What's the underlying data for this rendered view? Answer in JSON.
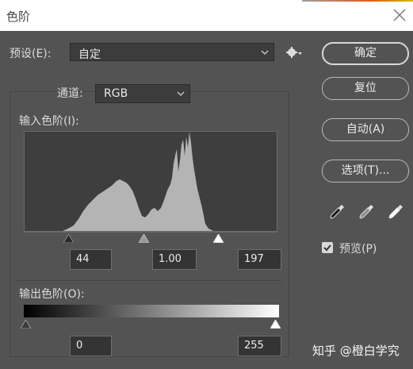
{
  "window": {
    "title": "色阶"
  },
  "preset": {
    "label": "预设(E):",
    "value": "自定"
  },
  "channel": {
    "label": "通道:",
    "value": "RGB"
  },
  "input_levels": {
    "label": "输入色阶(I):",
    "black": "44",
    "gamma": "1.00",
    "white": "197"
  },
  "output_levels": {
    "label": "输出色阶(O):",
    "black": "0",
    "white": "255"
  },
  "buttons": {
    "ok": "确定",
    "reset": "复位",
    "auto": "自动(A)",
    "options": "选项(T)..."
  },
  "preview": {
    "label": "预览(P)",
    "checked": true
  },
  "watermark": "知乎 @橙白学究",
  "icons": {
    "gear": "gear-icon",
    "close": "close-icon",
    "black_eyedropper": "eyedropper-black-icon",
    "gray_eyedropper": "eyedropper-gray-icon",
    "white_eyedropper": "eyedropper-white-icon"
  },
  "colors": {
    "background": "#535353",
    "histogram_fill": "#b4b4b4",
    "titlebar": "#ffffff"
  }
}
